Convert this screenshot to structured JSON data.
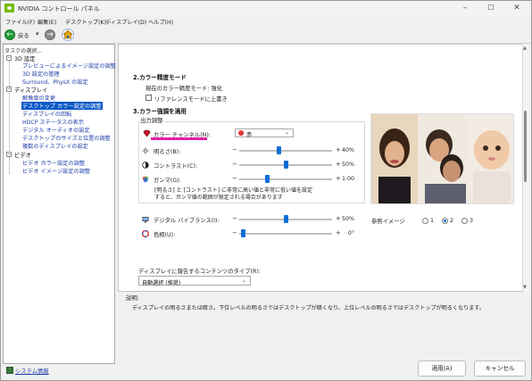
{
  "window": {
    "title": "NVIDIA コントロール パネル",
    "minimize": "–",
    "maximize": "☐",
    "close": "✕"
  },
  "menu": [
    "ファイル(F)",
    "編集(E)",
    "デスクトップ(K)",
    "ディスプレイ(D)",
    "ヘルプ(H)"
  ],
  "toolbar": {
    "back_label": "戻る",
    "dropdown_arrow": "▾"
  },
  "sidebar": {
    "header": "タスクの選択...",
    "categories": [
      {
        "label": "3D 設定",
        "expander": "−",
        "items": [
          "プレビューによるイメージ設定の調整",
          "3D 設定の管理",
          "Surround、PhysX の設定"
        ]
      },
      {
        "label": "ディスプレイ",
        "expander": "−",
        "items": [
          "解像度の変更",
          "デスクトップ カラー設定の調整",
          "ディスプレイの回転",
          "HDCP ステータスの表示",
          "デジタル オーディオの設定",
          "デスクトップのサイズと位置の調整",
          "複数のディスプレイの設定"
        ]
      },
      {
        "label": "ビデオ",
        "expander": "−",
        "items": [
          "ビデオ カラー設定の調整",
          "ビデオ イメージ設定の調整"
        ]
      }
    ],
    "selected": "デスクトップ カラー設定の調整",
    "system_info": "システム情報"
  },
  "main": {
    "section2_title": "2.カラー精度モード",
    "section2_current": "現在のカラー精度モード: 強化",
    "override_label": "リファレンスモードに上書き",
    "section3_title": "3.カラー強調を適用",
    "output_label": "出力調整",
    "channel_label": "カラー チャンネル(N):",
    "channel_value": "赤",
    "sliders": [
      {
        "name": "brightness",
        "label": "明るさ(B):",
        "value": "40%",
        "pos": 0.42
      },
      {
        "name": "contrast",
        "label": "コントラスト(C):",
        "value": "50%",
        "pos": 0.5
      },
      {
        "name": "gamma",
        "label": "ガンマ(G):",
        "value": "1.00",
        "pos": 0.3
      }
    ],
    "note_line1": "[明るさ] と [コントラスト] に非常に高い値と非常に低い値を設定",
    "note_line2": "すると、ガンマ値の範囲が限定される場合があります",
    "sliders2": [
      {
        "name": "digital-vibrance",
        "label": "デジタル バイブランス(I):",
        "value": "50%",
        "pos": 0.5
      },
      {
        "name": "hue",
        "label": "色相(U):",
        "value": "0°",
        "pos": 0.04
      }
    ],
    "minus": "−",
    "plus": "+",
    "reference_label": "参照イメージ",
    "reference_options": [
      "1",
      "2",
      "3"
    ],
    "reference_selected": "2",
    "content_type_label": "ディスプレイに報告するコンテンツのタイプ(R):",
    "content_type_value": "自動選択 (推奨)",
    "description_label": "説明:",
    "description_text": "ディスプレイの明るさまたは暗さ。下位レベルの明るさではデスクトップが暗くなり、上位レベルの明るさではデスクトップが明るくなります。"
  },
  "buttons": {
    "apply": "適用(A)",
    "cancel": "キャンセル"
  },
  "colors": {
    "accent": "#0b6fd6",
    "selection": "#0a58c8",
    "highlight_magenta": "#e51ea8",
    "nvidia_green": "#76b900"
  }
}
